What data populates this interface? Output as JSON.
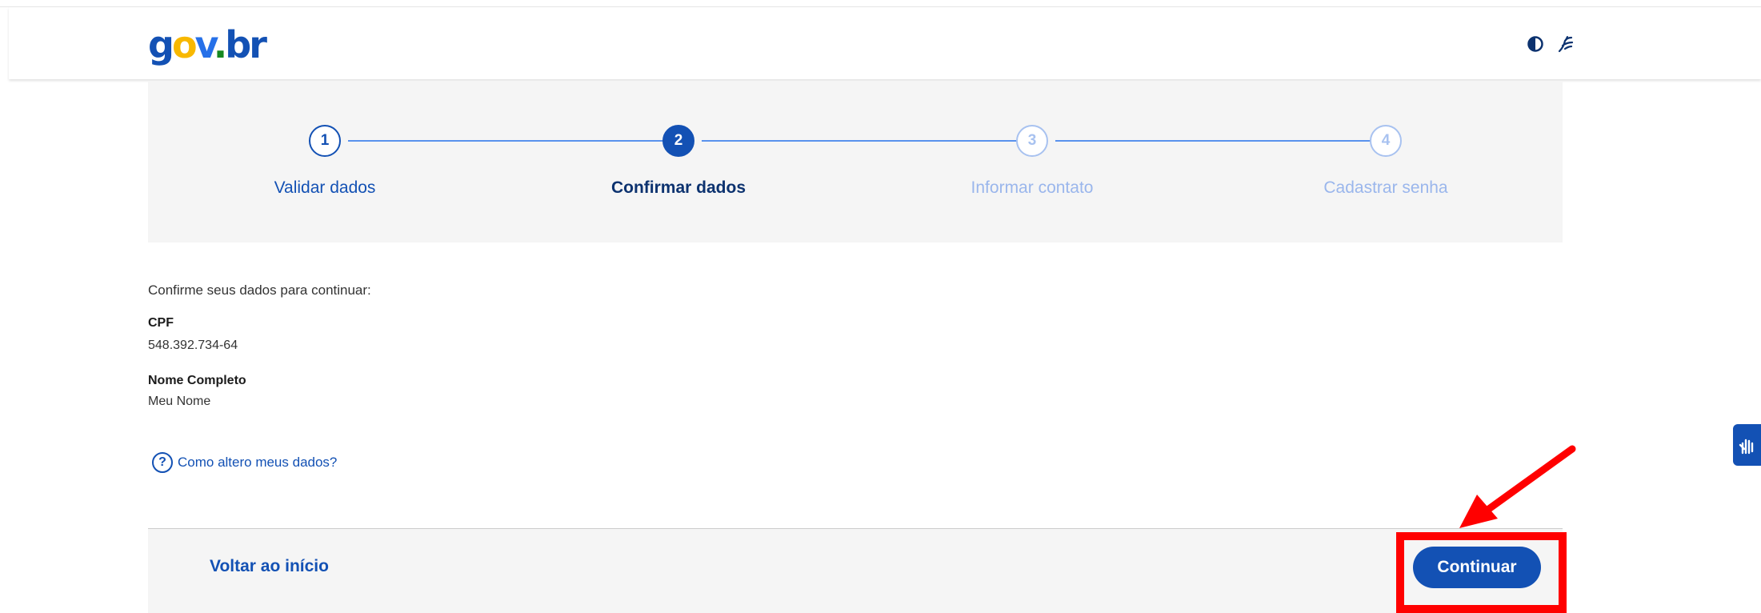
{
  "header": {
    "logo": {
      "g": "g",
      "o": "o",
      "v": "v",
      "dot": ".",
      "b": "b",
      "r": "r"
    },
    "icons": [
      "contrast-icon",
      "libras-hand-icon"
    ]
  },
  "stepper": {
    "steps": [
      {
        "number": "1",
        "label": "Validar dados",
        "state": "done"
      },
      {
        "number": "2",
        "label": "Confirmar dados",
        "state": "active"
      },
      {
        "number": "3",
        "label": "Informar contato",
        "state": "future"
      },
      {
        "number": "4",
        "label": "Cadastrar senha",
        "state": "future"
      }
    ]
  },
  "main": {
    "intro": "Confirme seus dados para continuar:",
    "fields": [
      {
        "label": "CPF",
        "value": "548.392.734-64"
      },
      {
        "label": "Nome Completo",
        "value": "Meu Nome"
      }
    ],
    "help_link": "Como altero meus dados?",
    "help_icon": "?"
  },
  "footer": {
    "back_label": "Voltar ao início",
    "continue_label": "Continuar"
  },
  "colors": {
    "primary": "#1351b4",
    "annotation": "#ff0000"
  }
}
